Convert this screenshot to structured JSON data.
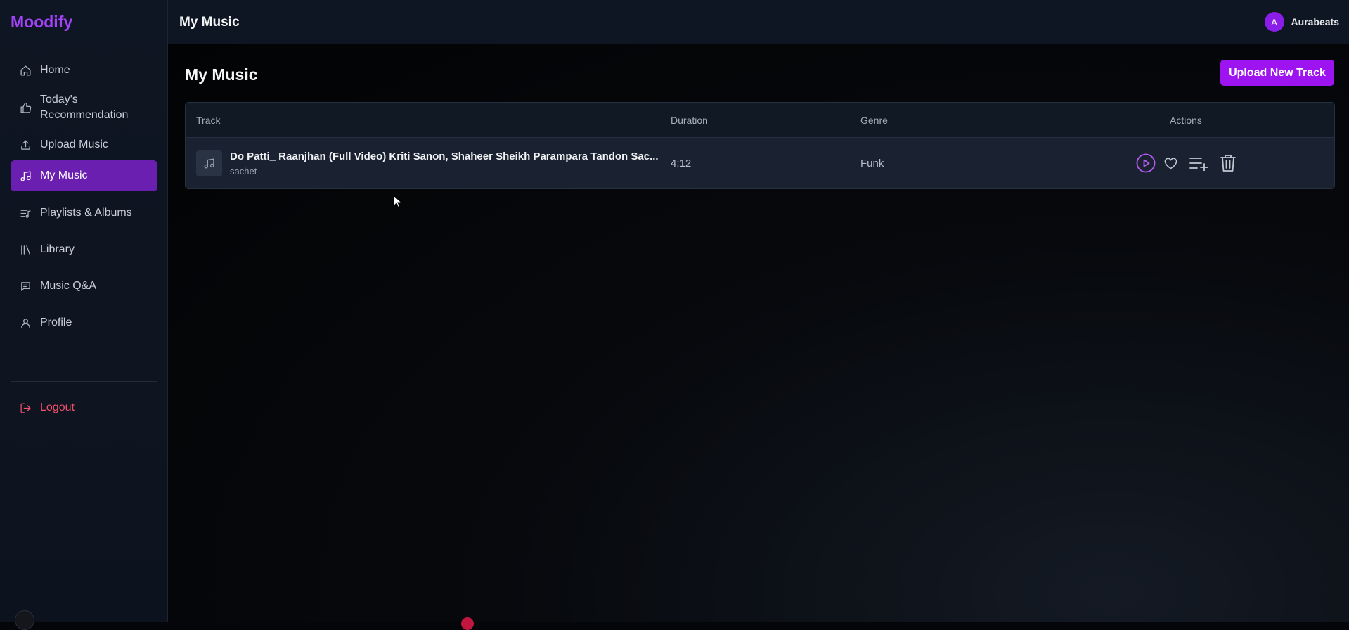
{
  "app": {
    "brand": "Moodify",
    "header_title": "My Music",
    "user": {
      "avatar_initial": "A",
      "name": "Aurabeats"
    }
  },
  "sidebar": {
    "items": [
      {
        "label": "Home",
        "icon": "home-icon"
      },
      {
        "label": "Today's Recommendation",
        "icon": "thumbs-up-icon"
      },
      {
        "label": "Upload Music",
        "icon": "upload-icon"
      },
      {
        "label": "My Music",
        "icon": "music-note-icon",
        "active": true
      },
      {
        "label": "Playlists & Albums",
        "icon": "playlist-icon"
      },
      {
        "label": "Library",
        "icon": "library-icon"
      },
      {
        "label": "Music Q&A",
        "icon": "chat-icon"
      },
      {
        "label": "Profile",
        "icon": "user-icon"
      }
    ],
    "logout": "Logout"
  },
  "main": {
    "title": "My Music",
    "upload_button": "Upload New Track",
    "table": {
      "columns": [
        "Track",
        "Duration",
        "Genre",
        "Actions"
      ],
      "rows": [
        {
          "title": "Do Patti_ Raanjhan (Full Video) Kriti Sanon, Shaheer Sheikh Parampara Tandon Sac...",
          "artist": "sachet",
          "duration": "4:12",
          "genre": "Funk",
          "actions": [
            "play-icon",
            "heart-icon",
            "add-to-queue-icon",
            "trash-icon"
          ]
        }
      ]
    }
  },
  "colors": {
    "accent": "#9d14f0",
    "active_nav": "#6b1fb0",
    "logout": "#f0506a",
    "background": "#05060a"
  }
}
